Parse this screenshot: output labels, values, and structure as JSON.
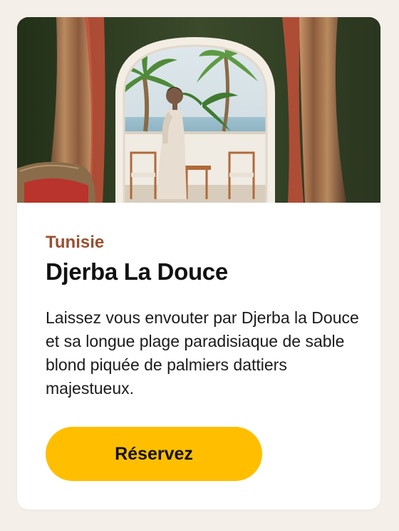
{
  "card": {
    "image": {
      "alt": "Femme sur un balcon face à la mer entre des palmiers"
    },
    "eyebrow": "Tunisie",
    "title": "Djerba La Douce",
    "description": "Laissez vous envouter par Djerba la Douce et sa longue plage paradisiaque de sable blond piquée de palmiers dattiers majestueux.",
    "cta_label": "Réservez"
  },
  "colors": {
    "page_background": "#f4efe9",
    "card_background": "#ffffff",
    "eyebrow": "#9a4f31",
    "title": "#111111",
    "cta_background": "#ffbf00"
  }
}
